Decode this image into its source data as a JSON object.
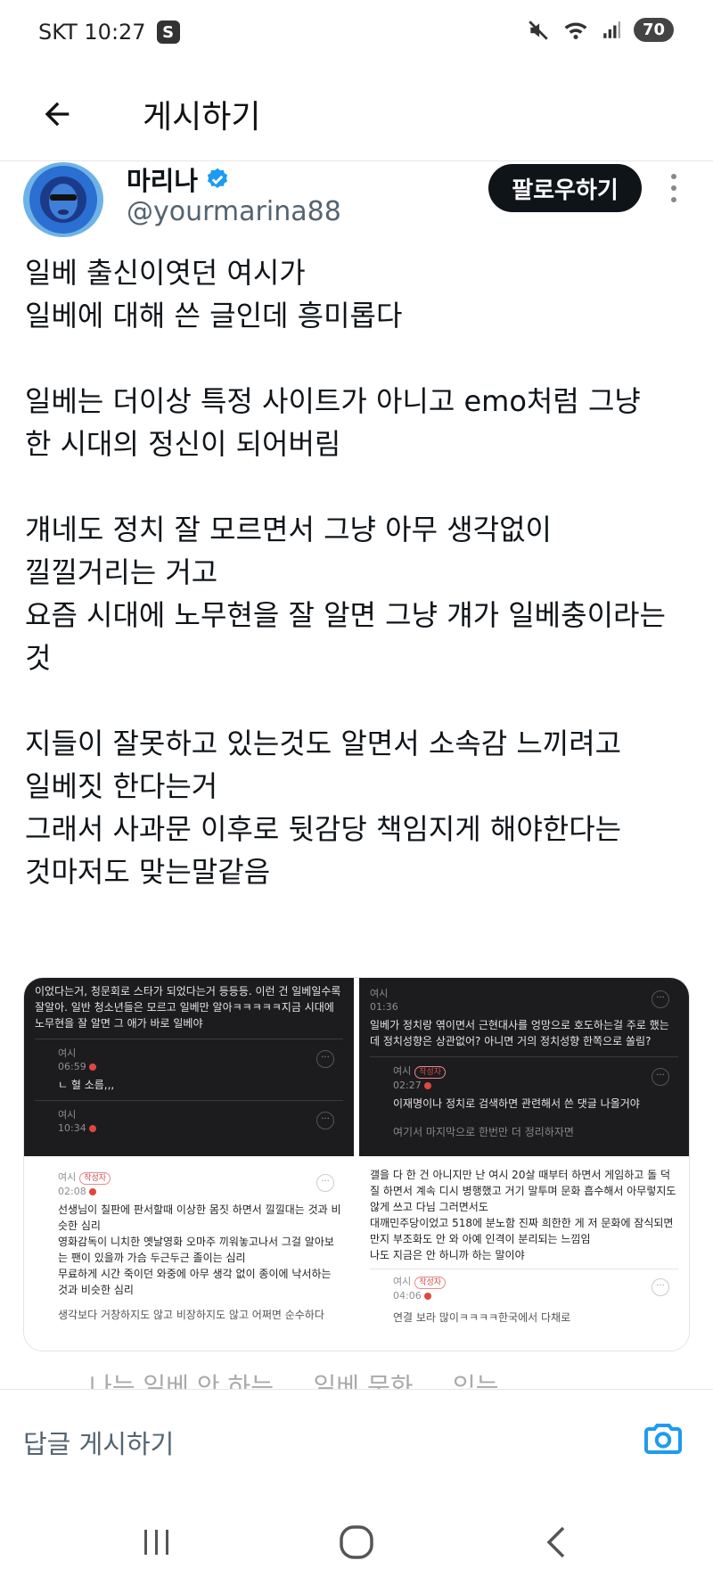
{
  "status_bar": {
    "carrier_time": "SKT 10:27",
    "s_badge": "S",
    "battery": "70"
  },
  "header": {
    "title": "게시하기"
  },
  "author": {
    "name": "마리나",
    "handle": "@yourmarina88",
    "follow_label": "팔로우하기"
  },
  "tweet": {
    "paragraphs": [
      "일베 출신이엿던 여시가\n일베에 대해 쓴 글인데 흥미롭다",
      "일베는 더이상 특정 사이트가 아니고 emo처럼 그냥\n한 시대의 정신이 되어버림",
      "걔네도 정치 잘 모르면서 그냥 아무 생각없이\n낄낄거리는 거고\n요즘 시대에 노무현을 잘 알면 그냥 걔가 일베충이라는\n것",
      "지들이 잘못하고 있는것도 알면서 소속감 느끼려고\n일베짓 한다는거\n그래서 사과문 이후로 뒷감당 책임지게 해야한다는\n것마저도 맞는말같음"
    ]
  },
  "media": {
    "left": {
      "top_text": "이었다는거, 청문회로 스타가 되었다는거 등등등. 이런 건 일베일수록 잘알아. 일반 청소년들은 모르고 일베만 알아ㅋㅋㅋㅋㅋ지금 시대에 노무현을 잘 알면 그 애가 바로 일베야",
      "c1_author": "여시",
      "c1_time": "06:59",
      "c1_text": "ㄴ 혈 소름,,,",
      "c2_author": "여시",
      "c2_time": "10:34",
      "c3_author": "여시",
      "c3_tag": "작성자",
      "c3_time": "02:08",
      "c3_text": "선생님이 칠판에 판서할때 이상한 몸짓 하면서 낄낄대는 것과 비슷한 심리\n영화감독이 니치한 옛날영화 오마주 끼워놓고나서 그걸 알아보는 팬이 있을까 가슴 두근두근 졸이는 심리\n무료하게 시간 죽이던 와중에 아무 생각 없이 종이에 낙서하는 것과 비슷한 심리",
      "c3_more": "생각보다 거창하지도 않고 비장하지도 않고 어쩌면 순수하다"
    },
    "right": {
      "c1_author": "여시",
      "c1_time": "01:36",
      "c1_text": "일베가 정치랑 엮이면서 근현대사를 엉망으로 호도하는걸 주로 했는데 정치성향은 상관없어? 아니면 거의 정치성향 한쪽으로 쏠림?",
      "c2_author": "여시",
      "c2_tag": "작성자",
      "c2_time": "02:27",
      "c2_text": "이재명이나 정치로 검색하면 관련해서 쓴 댓글 나올거야",
      "c2_more": "여기서 마지막으로 한번만 더 정리하자면",
      "c3_text": "갤을 다 한 건 아니지만 난 여시 20살 때부터 하면서 게임하고 돌 덕질 하면서 계속 디시 병행했고 거기 말투며 문화 흡수해서 아무렇지도 않게 쓰고 다님 그러면서도\n대깨민주당이었고 518에 분노함 진짜 희한한 게 저 문화에 잠식되면 만지 부조화도 안 와 아예 인격이 분리되는 느낌임\n나도 지금은 안 하니까 하는 말이야",
      "c4_author": "여시",
      "c4_tag": "작성자",
      "c4_time": "04:06",
      "c4_more": "연결 보라 많이ㅋㅋㅋㅋ한국에서 다채로"
    }
  },
  "overflow_text": "나는 일베 안 하는 ... 일베 문화 ... 있는 ...",
  "reply": {
    "placeholder": "답글 게시하기"
  },
  "colors": {
    "follow_bg": "#0f1419",
    "verified": "#1d9bf0",
    "camera": "#1d9bf0"
  }
}
